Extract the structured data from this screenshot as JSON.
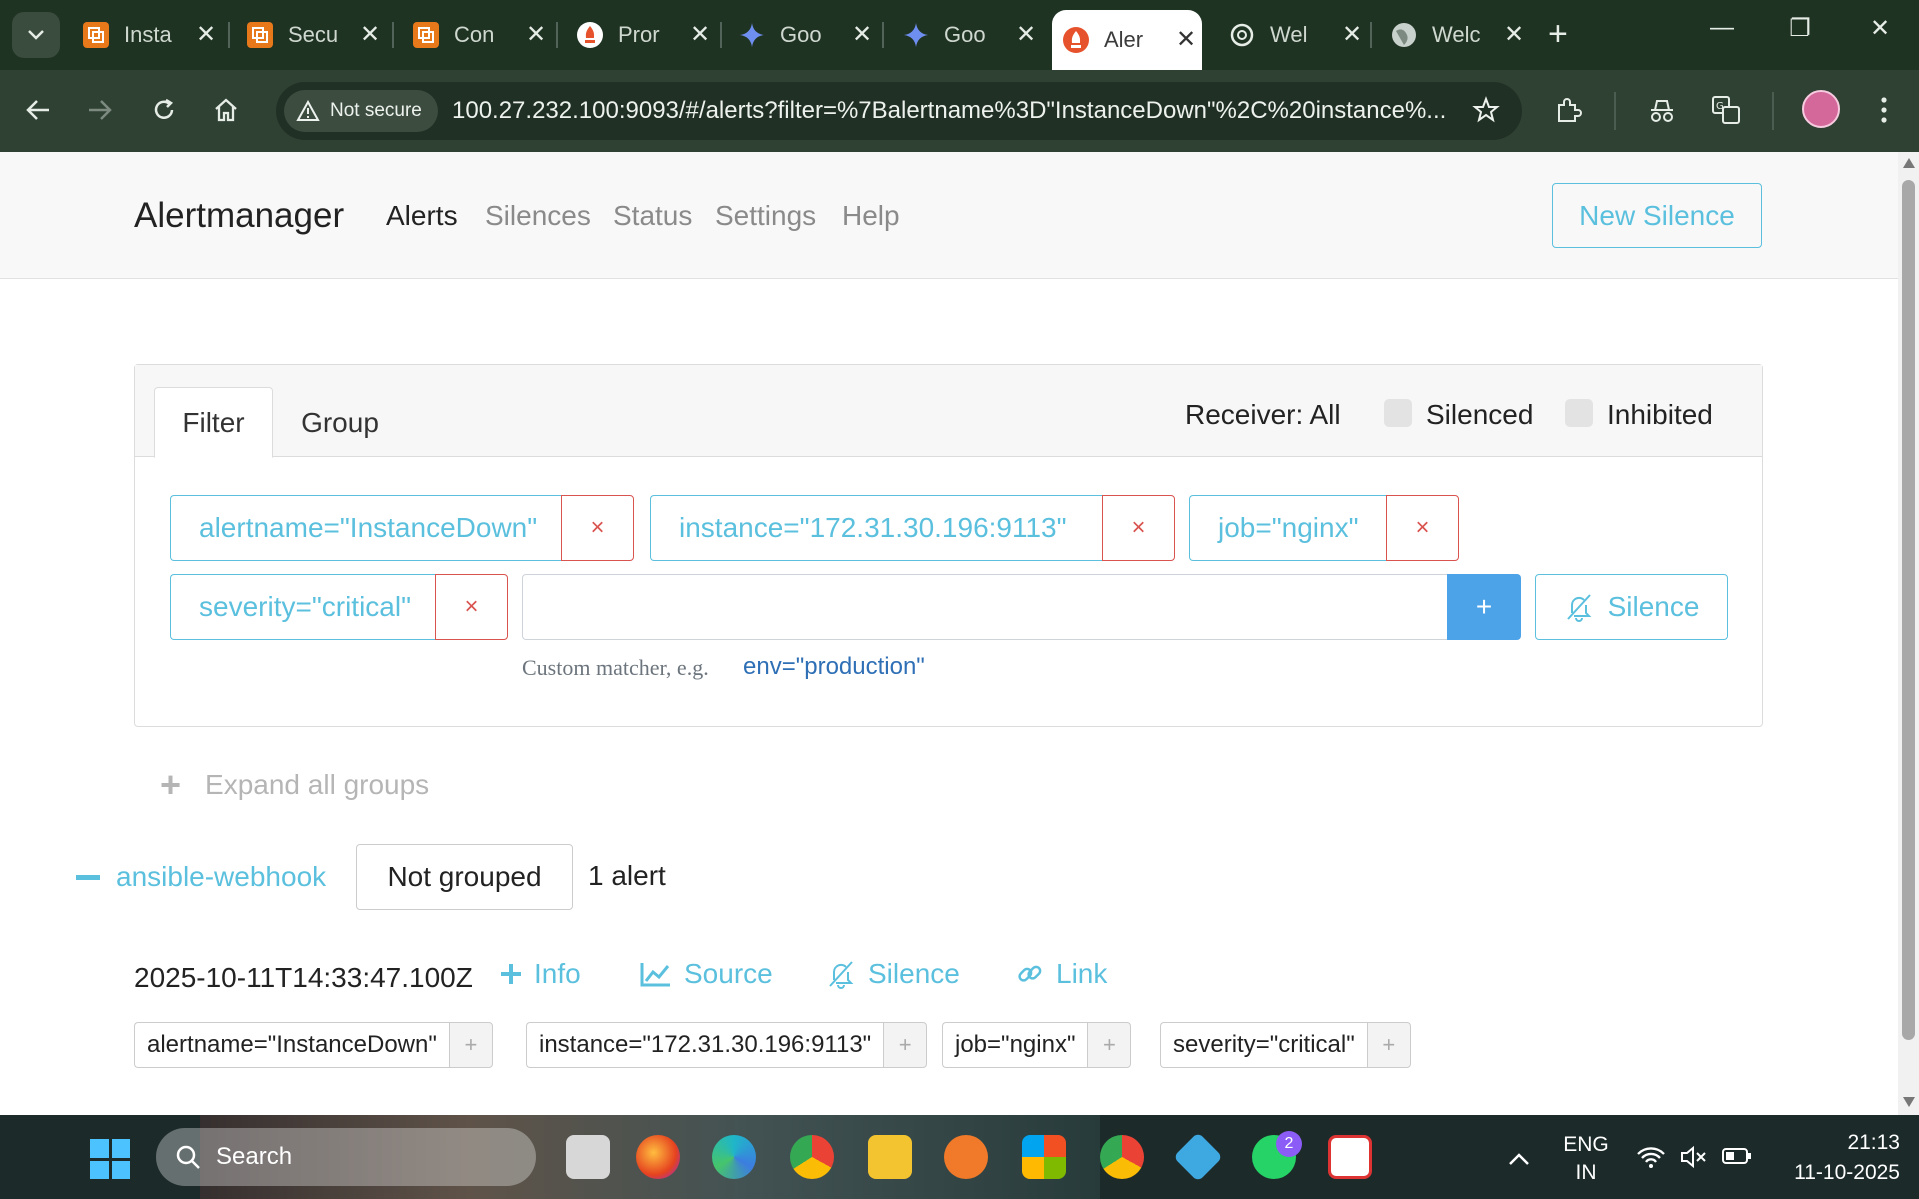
{
  "browser": {
    "tabs": [
      {
        "title": "Insta",
        "icon": "aws-icon"
      },
      {
        "title": "Secu",
        "icon": "aws-icon"
      },
      {
        "title": "Con",
        "icon": "aws-icon"
      },
      {
        "title": "Pror",
        "icon": "prometheus-icon"
      },
      {
        "title": "Goo",
        "icon": "gemini-icon"
      },
      {
        "title": "Goo",
        "icon": "gemini-icon"
      },
      {
        "title": "Aler",
        "icon": "prometheus-icon"
      },
      {
        "title": "Wel",
        "icon": "openai-icon"
      },
      {
        "title": "Welc",
        "icon": "globe-icon"
      }
    ],
    "security_chip": "Not secure",
    "url": "100.27.232.100:9093/#/alerts?filter=%7Balertname%3D\"InstanceDown\"%2C%20instance%..."
  },
  "nav": {
    "brand": "Alertmanager",
    "links": [
      "Alerts",
      "Silences",
      "Status",
      "Settings",
      "Help"
    ],
    "new_silence": "New Silence"
  },
  "filter_panel": {
    "tabs": [
      "Filter",
      "Group"
    ],
    "receiver": "Receiver: All",
    "silenced_label": "Silenced",
    "inhibited_label": "Inhibited",
    "matchers": [
      "alertname=\"InstanceDown\"",
      "instance=\"172.31.30.196:9113\"",
      "job=\"nginx\"",
      "severity=\"critical\""
    ],
    "remove_glyph": "×",
    "input_value": "",
    "add_glyph": "+",
    "silence_label": "Silence",
    "help_prefix": "Custom matcher, e.g.",
    "help_example": "env=\"production\""
  },
  "expand_all": "Expand all groups",
  "group": {
    "receiver": "ansible-webhook",
    "grouping": "Not grouped",
    "count": "1 alert"
  },
  "alert": {
    "timestamp": "2025-10-11T14:33:47.100Z",
    "actions": [
      "Info",
      "Source",
      "Silence",
      "Link"
    ],
    "labels": [
      "alertname=\"InstanceDown\"",
      "instance=\"172.31.30.196:9113\"",
      "job=\"nginx\"",
      "severity=\"critical\""
    ],
    "label_add_glyph": "+"
  },
  "taskbar": {
    "search_label": "Search",
    "whatsapp_badge": "2",
    "lang_top": "ENG",
    "lang_bottom": "IN",
    "time": "21:13",
    "date": "11-10-2025"
  },
  "colors": {
    "accent": "#5bc0de",
    "danger": "#d9534f",
    "primary_btn": "#4da3e8",
    "browser_frame": "#2f4133"
  }
}
